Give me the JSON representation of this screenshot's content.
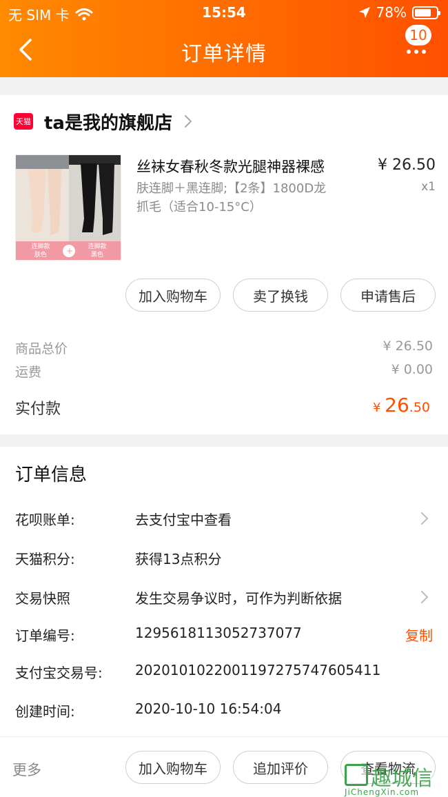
{
  "status_bar": {
    "carrier": "无 SIM 卡",
    "time": "15:54",
    "battery": "78%",
    "battery_level": 0.78
  },
  "nav": {
    "title": "订单详情",
    "badge_count": "10"
  },
  "shop": {
    "name": "ta是我的旗舰店",
    "platform_icon_text": "天猫"
  },
  "product": {
    "title": "丝袜女春秋冬款光腿神器裸感",
    "spec_line1": "肤连脚＋黑连脚;【2条】1800D龙",
    "spec_line2": "抓毛（适合10-15°C）",
    "price": "¥ 26.50",
    "qty": "x1",
    "image_label_left_1": "连脚款",
    "image_label_left_2": "肤色",
    "image_label_right_1": "连脚款",
    "image_label_right_2": "黑色"
  },
  "product_actions": [
    "加入购物车",
    "卖了换钱",
    "申请售后"
  ],
  "summary": {
    "goods_label": "商品总价",
    "goods_value": "¥ 26.50",
    "shipping_label": "运费",
    "shipping_value": "¥ 0.00",
    "paid_label": "实付款",
    "paid_yen": "¥ ",
    "paid_int": "26",
    "paid_dec": ".50"
  },
  "order_info": {
    "title": "订单信息",
    "huabei_label": "花呗账单:",
    "huabei_value": "去支付宝中查看",
    "points_label": "天猫积分:",
    "points_value": "获得13点积分",
    "snapshot_label": "交易快照",
    "snapshot_value": "发生交易争议时，可作为判断依据",
    "order_no_label": "订单编号:",
    "order_no_value": "1295618113052737077",
    "copy_label": "复制",
    "alipay_label": "支付宝交易号:",
    "alipay_value": "2020101022001197275747605411",
    "created_label": "创建时间:",
    "created_value": "2020-10-10 16:54:04"
  },
  "bottom_bar": {
    "more_label": "更多",
    "actions": [
      "加入购物车",
      "追加评价",
      "查看物流"
    ]
  },
  "watermark": {
    "text": "趣城信",
    "url": "JiChengXin.com"
  },
  "colors": {
    "accent": "#ff5000",
    "header_start": "#ff8a00",
    "header_end": "#ff5000",
    "tmall_red": "#ff0036"
  }
}
